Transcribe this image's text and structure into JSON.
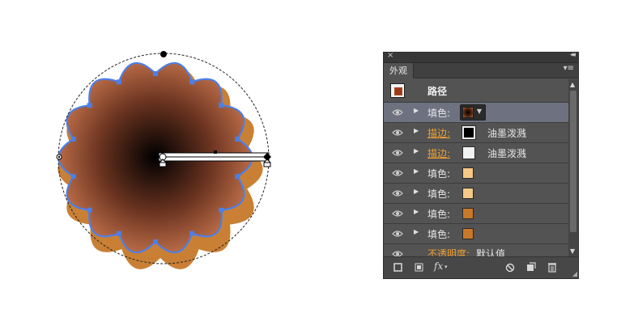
{
  "panel": {
    "close_label": "×",
    "collapse_label": "◂◂",
    "tab_label": "外观",
    "menu_label": "▾≡",
    "header_title": "路径",
    "rows": [
      {
        "label": "填色:",
        "swatch": "#5a2a14",
        "type": "fill-dropdown",
        "selected": true
      },
      {
        "label": "描边:",
        "swatch": "#000000",
        "type": "stroke",
        "ink": "油墨泼溅"
      },
      {
        "label": "描边:",
        "swatch": "#f2f2f2",
        "type": "stroke",
        "ink": "油墨泼溅"
      },
      {
        "label": "填色:",
        "swatch": "#f6c987",
        "type": "fill"
      },
      {
        "label": "填色:",
        "swatch": "#f6c987",
        "type": "fill"
      },
      {
        "label": "填色:",
        "swatch": "#c9782a",
        "type": "fill"
      },
      {
        "label": "填色:",
        "swatch": "#c9782a",
        "type": "fill"
      }
    ],
    "opacity_label": "不透明度:",
    "opacity_value": "默认值",
    "bottom": {
      "fx_label": "fx"
    }
  },
  "colors": {
    "panel_bg": "#535353",
    "selected_row": "#6e7280",
    "orange_label": "#f0a030",
    "gradient_center": "#000000",
    "gradient_edge": "#b86a46",
    "outer_fill": "#c98034",
    "anchor_blue": "#4d7fe6"
  }
}
